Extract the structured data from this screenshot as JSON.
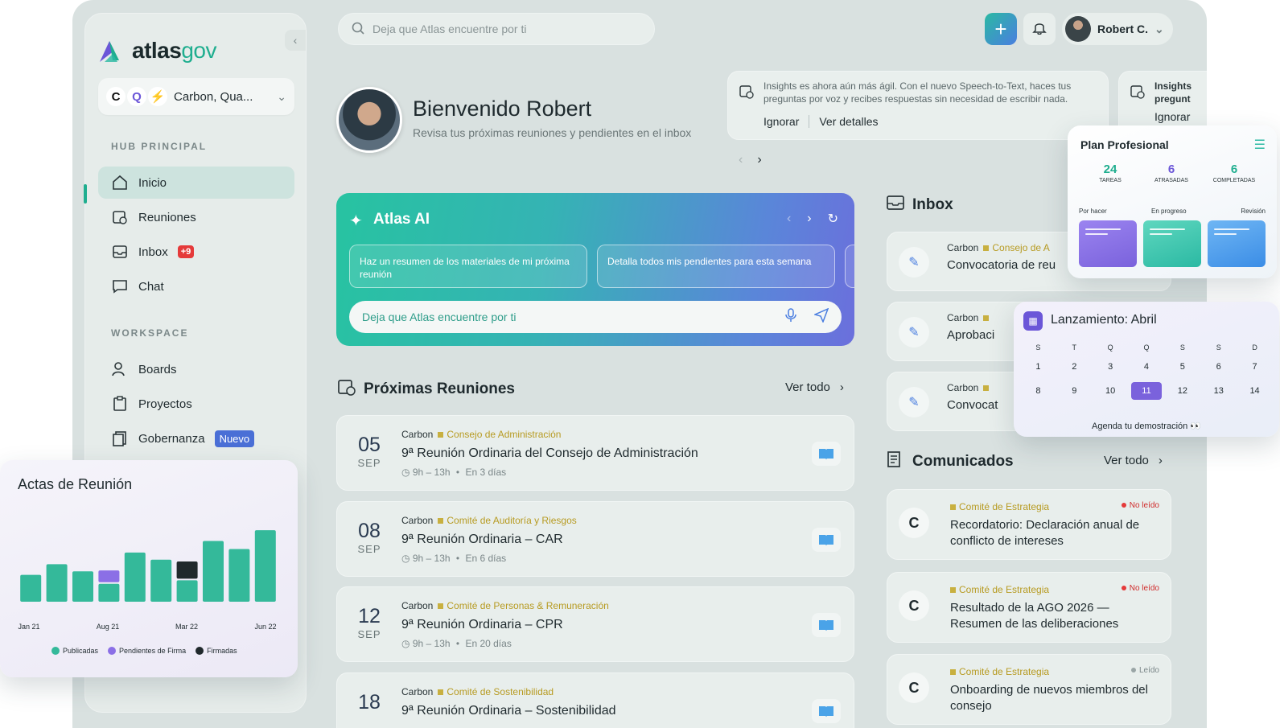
{
  "app": {
    "logo_main": "atlas",
    "logo_accent": "gov",
    "org_switcher": "Carbon, Qua..."
  },
  "colors": {
    "accent": "#1fae8f",
    "primary_blue": "#4a7ee0",
    "purple": "#7a62dc",
    "alert_red": "#e53a3a",
    "category_gold": "#c8b040"
  },
  "sidebar": {
    "hub_title": "HUB PRINCIPAL",
    "hub_items": [
      {
        "label": "Inicio",
        "icon": "home-icon",
        "active": true
      },
      {
        "label": "Reuniones",
        "icon": "calendar-clock-icon"
      },
      {
        "label": "Inbox",
        "icon": "inbox-icon",
        "badge": "+9"
      },
      {
        "label": "Chat",
        "icon": "chat-icon"
      }
    ],
    "workspace_title": "WORKSPACE",
    "workspace_items": [
      {
        "label": "Boards",
        "icon": "users-icon"
      },
      {
        "label": "Proyectos",
        "icon": "clipboard-icon"
      },
      {
        "label": "Gobernanza",
        "icon": "documents-icon",
        "badge": "Nuevo"
      }
    ]
  },
  "topbar": {
    "search_placeholder": "Deja que Atlas encuentre por ti",
    "user_name": "Robert C."
  },
  "welcome": {
    "title": "Bienvenido Robert",
    "subtitle": "Revisa tus próximas reuniones y pendientes en el inbox"
  },
  "insights": [
    {
      "text": "Insights es ahora aún más ágil. Con el nuevo Speech-to-Text, haces tus preguntas por voz y recibes respuestas sin necesidad de escribir nada.",
      "ignore": "Ignorar",
      "details": "Ver detalles"
    },
    {
      "text": "Insights",
      "text2": "pregunt",
      "ignore": "Ignorar"
    }
  ],
  "atlas_ai": {
    "title": "Atlas AI",
    "chips": [
      "Haz un resumen de los materiales de mi próxima reunión",
      "Detalla todos mis pendientes para esta semana"
    ],
    "input_placeholder": "Deja que Atlas encuentre por ti"
  },
  "meetings": {
    "title": "Próximas Reuniones",
    "see_all": "Ver todo",
    "items": [
      {
        "day": "05",
        "month": "SEP",
        "org": "Carbon",
        "category": "Consejo de Administración",
        "title": "9ª Reunión Ordinaria del Consejo de Administración",
        "time": "9h – 13h",
        "when": "En 3 días"
      },
      {
        "day": "08",
        "month": "SEP",
        "org": "Carbon",
        "category": "Comité de Auditoría y Riesgos",
        "title": "9ª Reunión Ordinaria – CAR",
        "time": "9h – 13h",
        "when": "En 6 días"
      },
      {
        "day": "12",
        "month": "SEP",
        "org": "Carbon",
        "category": "Comité de Personas & Remuneración",
        "title": "9ª Reunión Ordinaria – CPR",
        "time": "9h – 13h",
        "when": "En 20 días"
      },
      {
        "day": "18",
        "month": "",
        "org": "Carbon",
        "category": "Comité de Sostenibilidad",
        "title": "9ª Reunión Ordinaria – Sostenibilidad",
        "time": "",
        "when": ""
      }
    ]
  },
  "inbox": {
    "title": "Inbox",
    "items": [
      {
        "org": "Carbon",
        "category": "Consejo de A",
        "title": "Convocatoria de reu"
      },
      {
        "org": "Carbon",
        "category": "",
        "title": "Aprobaci"
      },
      {
        "org": "Carbon",
        "category": "",
        "title": "Convocat"
      }
    ]
  },
  "comunicados": {
    "title": "Comunicados",
    "see_all": "Ver todo",
    "items": [
      {
        "category": "Comité de Estrategia",
        "status": "No leído",
        "read": false,
        "title": "Recordatorio: Declaración anual de conflicto de intereses"
      },
      {
        "category": "Comité de Estrategia",
        "status": "No leído",
        "read": false,
        "title": "Resultado de la AGO 2026 — Resumen de las deliberaciones"
      },
      {
        "category": "Comité de Estrategia",
        "status": "Leído",
        "read": true,
        "title": "Onboarding de nuevos miembros del consejo"
      }
    ]
  },
  "plan": {
    "title": "Plan Profesional",
    "stats": [
      {
        "value": "24",
        "label": "TAREAS",
        "color": "#1fae8f"
      },
      {
        "value": "6",
        "label": "ATRASADAS",
        "color": "#6b56d8"
      },
      {
        "value": "6",
        "label": "COMPLETADAS",
        "color": "#1fae8f"
      }
    ],
    "columns": [
      "Por hacer",
      "En progreso",
      "Revisión"
    ]
  },
  "calendar": {
    "title": "Lanzamiento: Abril",
    "weekdays": [
      "S",
      "T",
      "Q",
      "Q",
      "S",
      "S",
      "D"
    ],
    "days": [
      "1",
      "2",
      "3",
      "4",
      "5",
      "6",
      "7",
      "8",
      "9",
      "10",
      "11",
      "12",
      "13",
      "14"
    ],
    "selected": "11",
    "footer": "Agenda tu demostración 👀"
  },
  "actas": {
    "title": "Actas de Reunión",
    "legend": [
      "Publicadas",
      "Pendientes de Firma",
      "Firmadas"
    ],
    "x_labels": [
      "Jan 21",
      "Aug 21",
      "Mar 22",
      "Jun 22"
    ]
  },
  "chart_data": {
    "type": "bar",
    "title": "Actas de Reunión",
    "categories": [
      "1",
      "2",
      "3",
      "4",
      "5",
      "6",
      "7",
      "8",
      "9",
      "10"
    ],
    "tick_labels": [
      "Jan 21",
      "Aug 21",
      "Mar 22",
      "Jun 22"
    ],
    "series": [
      {
        "name": "Publicadas",
        "color": "#34b99a",
        "values": [
          30,
          42,
          34,
          20,
          55,
          47,
          24,
          68,
          59,
          80
        ]
      },
      {
        "name": "Pendientes de Firma",
        "color": "#8b6fe6",
        "values": [
          0,
          0,
          0,
          15,
          0,
          0,
          0,
          0,
          0,
          0
        ]
      },
      {
        "name": "Firmadas",
        "color": "#20292c",
        "values": [
          0,
          0,
          0,
          0,
          0,
          0,
          21,
          0,
          0,
          0
        ]
      }
    ],
    "ylim": [
      0,
      90
    ],
    "grid": false,
    "legend_position": "bottom"
  }
}
